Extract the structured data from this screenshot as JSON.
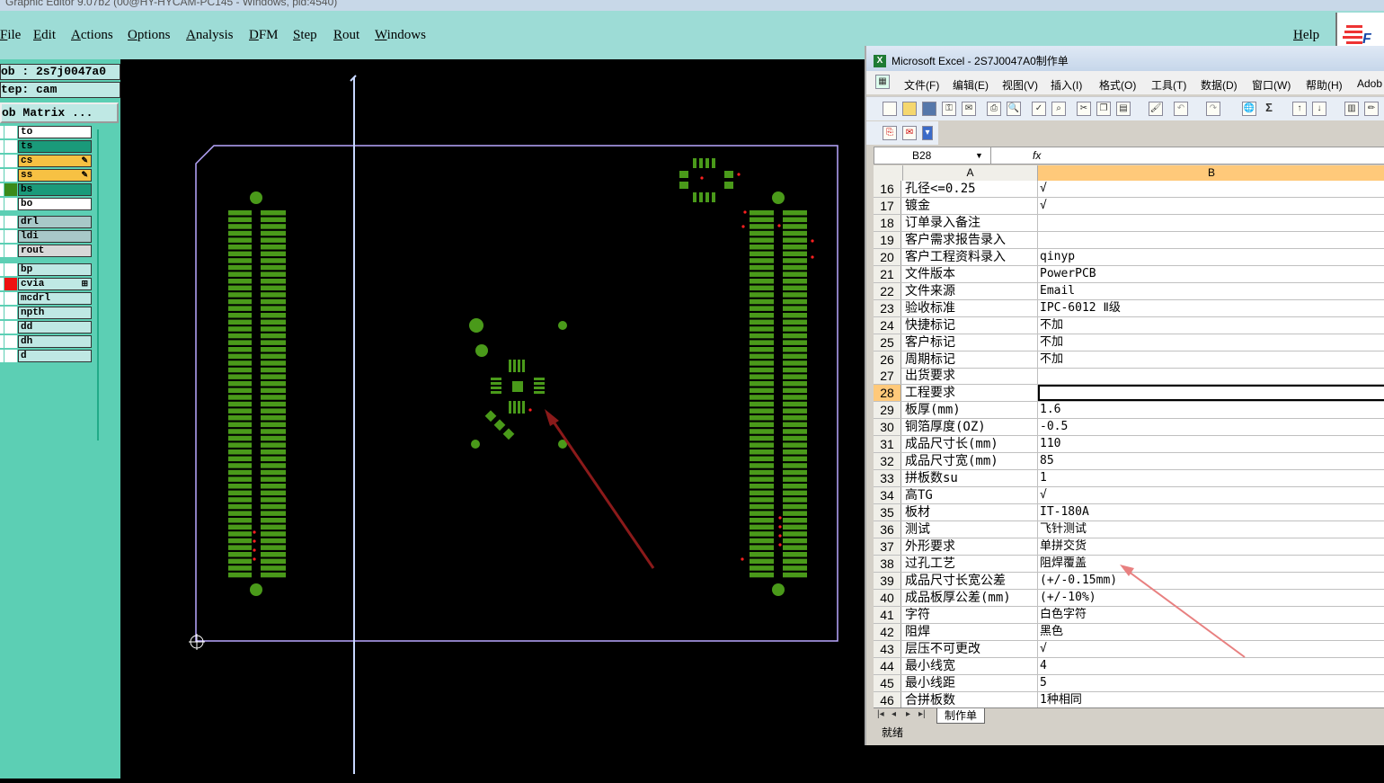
{
  "genesis": {
    "title": "Graphic Editor 9.07b2 (00@HY-HYCAM-PC145 - Windows, pid:4540)",
    "menu": [
      "File",
      "Edit",
      "Actions",
      "Options",
      "Analysis",
      "DFM",
      "Step",
      "Rout",
      "Windows"
    ],
    "help": "Help",
    "job_label": "ob : 2s7j0047a0",
    "step_label": "tep: cam",
    "job_matrix": "ob Matrix ...",
    "layers": [
      {
        "name": "to",
        "color": "#ffffff",
        "box": "#ffffff"
      },
      {
        "name": "ts",
        "color": "#1a9a7a",
        "box": "#ffffff"
      },
      {
        "name": "cs",
        "color": "#f7c143",
        "box": "#ffffff",
        "mark": "✎"
      },
      {
        "name": "ss",
        "color": "#f7c143",
        "box": "#ffffff",
        "mark": "✎"
      },
      {
        "name": "bs",
        "color": "#1a9a7a",
        "box": "#3a8a1a"
      },
      {
        "name": "bo",
        "color": "#ffffff",
        "box": "#ffffff"
      },
      {
        "name": "drl",
        "color": "#a8c8c8",
        "box": "#ffffff"
      },
      {
        "name": "ldi",
        "color": "#a8c8c8",
        "box": "#ffffff"
      },
      {
        "name": "rout",
        "color": "#d8d8d8",
        "box": "#ffffff"
      },
      {
        "name": "bp",
        "color": "#bfe8e4",
        "box": "#ffffff"
      },
      {
        "name": "cvia",
        "color": "#bfe8e4",
        "box": "#ee1111",
        "mark": "⊞"
      },
      {
        "name": "mcdrl",
        "color": "#bfe8e4",
        "box": "#ffffff"
      },
      {
        "name": "npth",
        "color": "#bfe8e4",
        "box": "#ffffff"
      },
      {
        "name": "dd",
        "color": "#bfe8e4",
        "box": "#ffffff"
      },
      {
        "name": "dh",
        "color": "#bfe8e4",
        "box": "#ffffff"
      },
      {
        "name": "d",
        "color": "#bfe8e4",
        "box": "#ffffff"
      }
    ]
  },
  "excel": {
    "title": "Microsoft Excel - 2S7J0047A0制作单",
    "menu": [
      "文件(F)",
      "编辑(E)",
      "视图(V)",
      "插入(I)",
      "格式(O)",
      "工具(T)",
      "数据(D)",
      "窗口(W)",
      "帮助(H)",
      "Adob"
    ],
    "cell_ref": "B28",
    "fx": "fx",
    "col_a": "A",
    "col_b": "B",
    "rows": [
      {
        "n": "16",
        "a": "孔径<=0.25",
        "b": "√"
      },
      {
        "n": "17",
        "a": "镀金",
        "b": "√"
      },
      {
        "n": "18",
        "a": "订单录入备注",
        "b": ""
      },
      {
        "n": "19",
        "a": "客户需求报告录入",
        "b": ""
      },
      {
        "n": "20",
        "a": "客户工程资料录入",
        "b": "qinyp"
      },
      {
        "n": "21",
        "a": "文件版本",
        "b": "PowerPCB"
      },
      {
        "n": "22",
        "a": "文件来源",
        "b": "Email"
      },
      {
        "n": "23",
        "a": "验收标准",
        "b": "IPC-6012 Ⅱ级"
      },
      {
        "n": "24",
        "a": "快捷标记",
        "b": "不加"
      },
      {
        "n": "25",
        "a": "客户标记",
        "b": "不加"
      },
      {
        "n": "26",
        "a": "周期标记",
        "b": "不加"
      },
      {
        "n": "27",
        "a": "出货要求",
        "b": ""
      },
      {
        "n": "28",
        "a": "工程要求",
        "b": ""
      },
      {
        "n": "29",
        "a": "板厚(mm)",
        "b": "1.6"
      },
      {
        "n": "30",
        "a": "铜箔厚度(OZ)",
        "b": "-0.5"
      },
      {
        "n": "31",
        "a": "成品尺寸长(mm)",
        "b": "110"
      },
      {
        "n": "32",
        "a": "成品尺寸宽(mm)",
        "b": "85"
      },
      {
        "n": "33",
        "a": "拼板数su",
        "b": "1"
      },
      {
        "n": "34",
        "a": "高TG",
        "b": "√"
      },
      {
        "n": "35",
        "a": "板材",
        "b": "IT-180A"
      },
      {
        "n": "36",
        "a": "测试",
        "b": "飞针测试"
      },
      {
        "n": "37",
        "a": "外形要求",
        "b": "单拼交货"
      },
      {
        "n": "38",
        "a": "过孔工艺",
        "b": "阻焊覆盖"
      },
      {
        "n": "39",
        "a": "成品尺寸长宽公差",
        "b": "(+/-0.15mm)"
      },
      {
        "n": "40",
        "a": "成品板厚公差(mm)",
        "b": "(+/-10%)"
      },
      {
        "n": "41",
        "a": "字符",
        "b": "白色字符"
      },
      {
        "n": "42",
        "a": "阻焊",
        "b": "黑色"
      },
      {
        "n": "43",
        "a": "层压不可更改",
        "b": "√"
      },
      {
        "n": "44",
        "a": "最小线宽",
        "b": "4"
      },
      {
        "n": "45",
        "a": "最小线距",
        "b": "5"
      },
      {
        "n": "46",
        "a": "合拼板数",
        "b": "1种相同"
      }
    ],
    "selected_row": "28",
    "sheet_tab": "制作单",
    "status": "就绪"
  },
  "colors": {
    "pad_green": "#4a9a1a",
    "outline": "#b9a8ff",
    "arrow_dark": "#8b1a1a",
    "arrow_light": "#e88080"
  }
}
